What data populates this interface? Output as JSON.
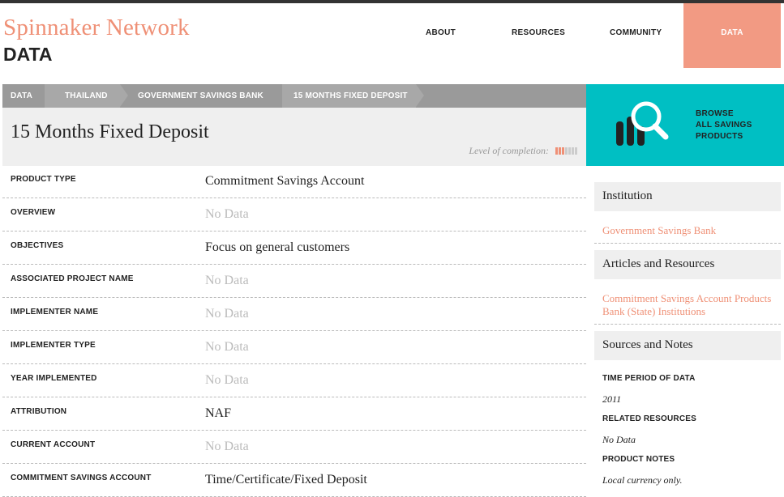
{
  "site": {
    "name": "Spinnaker Network",
    "section": "DATA"
  },
  "nav": {
    "about": "ABOUT",
    "resources": "RESOURCES",
    "community": "COMMUNITY",
    "data": "DATA"
  },
  "breadcrumb": [
    "DATA",
    "THAILAND",
    "GOVERNMENT SAVINGS BANK",
    "15 MONTHS FIXED DEPOSIT"
  ],
  "page": {
    "title": "15 Months Fixed Deposit",
    "completion_label": "Level of completion:",
    "completion_level": 0.3
  },
  "browse": {
    "line1": "BROWSE",
    "line2": "ALL SAVINGS",
    "line3": "PRODUCTS",
    "icon": "search-savings-icon"
  },
  "rows": [
    {
      "label": "PRODUCT TYPE",
      "value": "Commitment Savings Account",
      "nodata": false
    },
    {
      "label": "OVERVIEW",
      "value": "No Data",
      "nodata": true
    },
    {
      "label": "OBJECTIVES",
      "value": "Focus on general customers",
      "nodata": false
    },
    {
      "label": "ASSOCIATED PROJECT NAME",
      "value": "No Data",
      "nodata": true
    },
    {
      "label": "IMPLEMENTER NAME",
      "value": "No Data",
      "nodata": true
    },
    {
      "label": "IMPLEMENTER TYPE",
      "value": "No Data",
      "nodata": true
    },
    {
      "label": "YEAR IMPLEMENTED",
      "value": "No Data",
      "nodata": true
    },
    {
      "label": "ATTRIBUTION",
      "value": "NAF",
      "nodata": false
    },
    {
      "label": "CURRENT ACCOUNT",
      "value": "No Data",
      "nodata": true
    },
    {
      "label": "COMMITMENT SAVINGS ACCOUNT",
      "value": "Time/Certificate/Fixed Deposit",
      "nodata": false
    }
  ],
  "sidebar": {
    "institution_heading": "Institution",
    "institution_link": "Government Savings Bank",
    "articles_heading": "Articles and Resources",
    "articles_links": [
      "Commitment Savings Account Products",
      "Bank (State) Institutions"
    ],
    "sources_heading": "Sources and Notes",
    "time_period_label": "TIME PERIOD OF DATA",
    "time_period_value": "2011",
    "related_label": "RELATED RESOURCES",
    "related_value": "No Data",
    "notes_label": "PRODUCT NOTES",
    "notes_value": "Local currency only."
  },
  "colors": {
    "accent": "#ef9076",
    "teal": "#00bfc3",
    "nodata": "#bbbbbb"
  }
}
